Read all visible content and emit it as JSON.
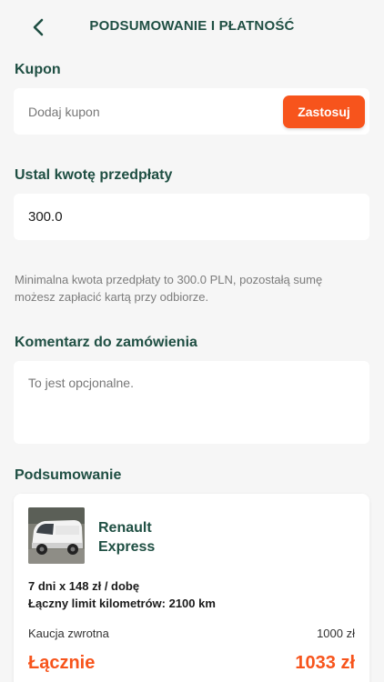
{
  "header": {
    "title": "PODSUMOWANIE I PŁATNOŚĆ",
    "back_icon": "chevron-left-icon"
  },
  "coupon": {
    "label": "Kupon",
    "placeholder": "Dodaj kupon",
    "value": "",
    "apply_label": "Zastosuj"
  },
  "prepayment": {
    "label": "Ustal kwotę przedpłaty",
    "value": "300.0",
    "help_text": "Minimalna kwota przedpłaty to 300.0 PLN, pozostałą sumę możesz zapłacić kartą przy odbiorze."
  },
  "comment": {
    "label": "Komentarz do zamówienia",
    "placeholder": "To jest opcjonalne."
  },
  "summary": {
    "label": "Podsumowanie",
    "car_name": "Renault Express",
    "car_image": "white-van-photo",
    "rate_line": "7 dni x 148 zł / dobę",
    "km_limit_line": "Łączny limit kilometrów: 2100 km",
    "deposit_label": "Kaucja zwrotna",
    "deposit_value": "1000 zł",
    "total_label": "Łącznie",
    "total_value": "1033 zł"
  },
  "colors": {
    "accent": "#f7541c",
    "primary_text": "#1f4f43",
    "background": "#f6f6f6",
    "card": "#ffffff"
  }
}
